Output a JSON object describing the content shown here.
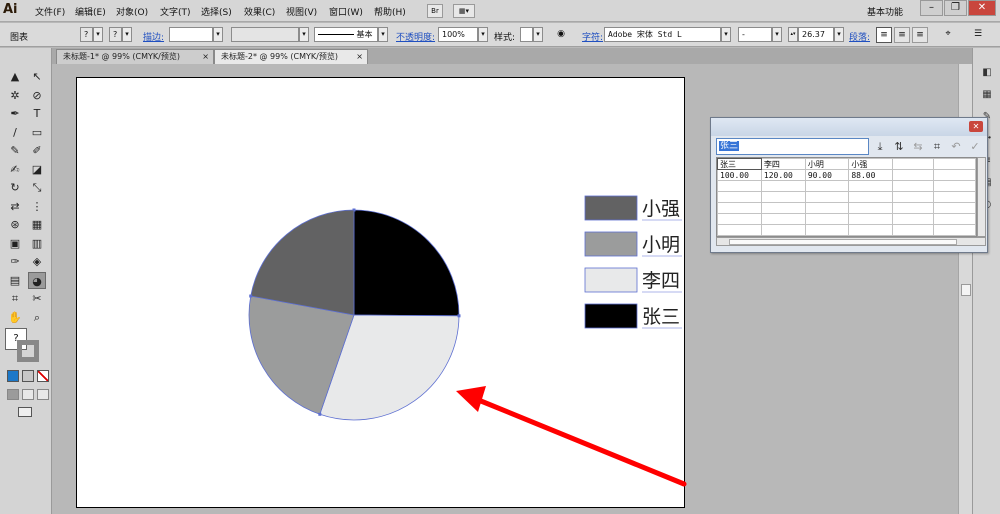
{
  "app": {
    "logo": "Ai"
  },
  "menu": {
    "items": [
      "文件(F)",
      "编辑(E)",
      "对象(O)",
      "文字(T)",
      "选择(S)",
      "效果(C)",
      "视图(V)",
      "窗口(W)",
      "帮助(H)"
    ],
    "bridge_label": "Br",
    "workspace": "基本功能",
    "win_minimize": "–",
    "win_restore": "❐",
    "win_close": "✕"
  },
  "control": {
    "selection_label": "图表",
    "q1": "?",
    "q2": "?",
    "stroke_label": "描边:",
    "stroke_style": "基本",
    "opacity_label": "不透明度:",
    "opacity_value": "100%",
    "style_label": "样式:",
    "char_label": "字符:",
    "font_family": "Adobe 宋体 Std L",
    "font_style": "-",
    "font_size": "26.37",
    "para_label": "段落:"
  },
  "tabs": [
    {
      "label": "未标题-1* @ 99% (CMYK/预览)",
      "close": "×"
    },
    {
      "label": "未标题-2* @ 99% (CMYK/预览)",
      "close": "×"
    }
  ],
  "tools": {
    "icons": [
      "▲",
      "↖",
      "✲",
      "⊘",
      "✒",
      "T",
      "/",
      "▭",
      "✎",
      "✐",
      "✍",
      "◪",
      "↻",
      "⤡",
      "⇄",
      "⋮",
      "⊛",
      "▦",
      "▣",
      "▥",
      "✑",
      "◈",
      "▤",
      "◕",
      "⌗",
      "✂",
      "✋",
      "⌕"
    ],
    "fill_stroke": "?"
  },
  "chart_data": {
    "type": "pie",
    "categories": [
      "张三",
      "李四",
      "小明",
      "小强"
    ],
    "values": [
      100,
      120,
      90,
      88
    ],
    "colors": [
      "#000000",
      "#e8e9ea",
      "#9b9c9c",
      "#626263"
    ],
    "legend_order": [
      "小强",
      "小明",
      "李四",
      "张三"
    ],
    "legend_position": "right",
    "title": "",
    "outline_color": "#5d6fd1"
  },
  "graph_data": {
    "entry_value": "张三",
    "rows": [
      [
        "张三",
        "李四",
        "小明",
        "小强",
        "",
        ""
      ],
      [
        "100.00",
        "120.00",
        "90.00",
        "88.00",
        "",
        ""
      ],
      [
        "",
        "",
        "",
        "",
        "",
        ""
      ],
      [
        "",
        "",
        "",
        "",
        "",
        ""
      ],
      [
        "",
        "",
        "",
        "",
        "",
        ""
      ],
      [
        "",
        "",
        "",
        "",
        "",
        ""
      ],
      [
        "",
        "",
        "",
        "",
        "",
        ""
      ]
    ]
  },
  "annotation": {
    "arrow_color": "#ff0000"
  }
}
